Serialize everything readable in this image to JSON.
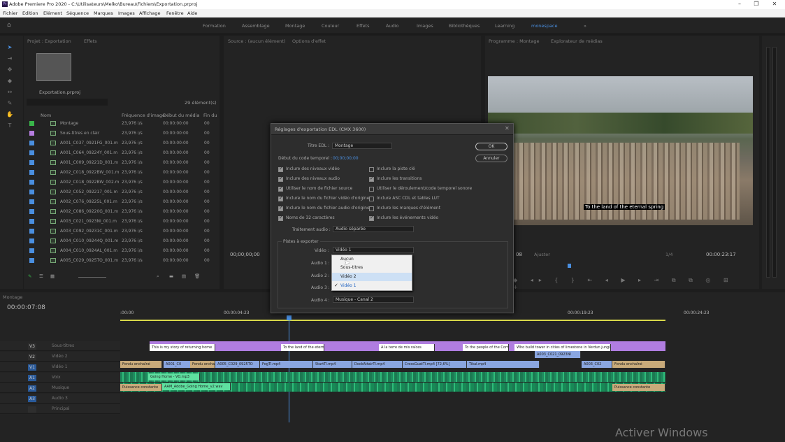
{
  "app": {
    "title": "Adobe Premiere Pro 2020 - C:\\Utilisateurs\\Melko\\Bureau\\Fichiers\\Exportation.prproj",
    "logo": "Pr"
  },
  "menu": [
    "Fichier",
    "Edition",
    "Elément",
    "Séquence",
    "Marques",
    "Images",
    "Affichage",
    "Fenêtre",
    "Aide"
  ],
  "workspaces": [
    "Formation",
    "Assemblage",
    "Montage",
    "Couleur",
    "Effets",
    "Audio",
    "Images",
    "Bibliothèques",
    "Learning",
    "monespace"
  ],
  "project": {
    "tab": "Projet : Exportation",
    "tab2": "Effets",
    "file": "Exportation.prproj",
    "count": "29 élément(s)",
    "cols": [
      "Nom",
      "Fréquence d'image",
      "Début du média",
      "Fin du"
    ],
    "rows": [
      {
        "name": "Montage",
        "fps": "23,976 i/s",
        "start": "00:00:00:00",
        "end": "00",
        "color": "#39b54a"
      },
      {
        "name": "Sous-titres en clair",
        "fps": "23,976 i/s",
        "start": "00:00:00:00",
        "end": "00",
        "color": "#b57de0"
      },
      {
        "name": "A001_C037_0921FG_001.m",
        "fps": "23,976 i/s",
        "start": "00:00:00:00",
        "end": "00",
        "color": "#4a8fe0"
      },
      {
        "name": "A001_C064_09224Y_001.m",
        "fps": "23,976 i/s",
        "start": "00:00:00:00",
        "end": "00",
        "color": "#4a8fe0"
      },
      {
        "name": "A001_C009_09221D_001.m",
        "fps": "23,976 i/s",
        "start": "00:00:00:00",
        "end": "00",
        "color": "#4a8fe0"
      },
      {
        "name": "A002_C018_0922BW_001.m",
        "fps": "23,976 i/s",
        "start": "00:00:00:00",
        "end": "00",
        "color": "#4a8fe0"
      },
      {
        "name": "A002_C018_0922BW_002.m",
        "fps": "23,976 i/s",
        "start": "00:00:00:00",
        "end": "00",
        "color": "#4a8fe0"
      },
      {
        "name": "A002_C052_092217_001.m",
        "fps": "23,976 i/s",
        "start": "00:00:00:00",
        "end": "00",
        "color": "#4a8fe0"
      },
      {
        "name": "A002_C076_09225L_001.m",
        "fps": "23,976 i/s",
        "start": "00:00:00:00",
        "end": "00",
        "color": "#4a8fe0"
      },
      {
        "name": "A002_C086_09220G_001.m",
        "fps": "23,976 i/s",
        "start": "00:00:00:00",
        "end": "00",
        "color": "#4a8fe0"
      },
      {
        "name": "A003_C021_0923NI_001.m",
        "fps": "23,976 i/s",
        "start": "00:00:00:00",
        "end": "00",
        "color": "#4a8fe0"
      },
      {
        "name": "A003_C092_09231C_001.m",
        "fps": "23,976 i/s",
        "start": "00:00:00:00",
        "end": "00",
        "color": "#4a8fe0"
      },
      {
        "name": "A004_C010_09244Q_001.m",
        "fps": "23,976 i/s",
        "start": "00:00:00:00",
        "end": "00",
        "color": "#4a8fe0"
      },
      {
        "name": "A004_C010_0924AL_001.m",
        "fps": "23,976 i/s",
        "start": "00:00:00:00",
        "end": "00",
        "color": "#4a8fe0"
      },
      {
        "name": "A005_C029_0925TO_001.m",
        "fps": "23,976 i/s",
        "start": "00:00:00:00",
        "end": "00",
        "color": "#4a8fe0"
      }
    ]
  },
  "source": {
    "tab": "Source : (aucun élément)",
    "tab2": "Options d'effet",
    "timecode": "00;00;00;00"
  },
  "program": {
    "tab": "Programme : Montage",
    "tab2": "Explorateur de médias",
    "subtitle": "To the land of the eternal spring",
    "timecode": "00:00:23:17",
    "fit": "Ajuster",
    "ratio": "1/4",
    "left_tc": "08"
  },
  "dialog": {
    "title": "Réglages d'exportation EDL (CMX 3600)",
    "title_label": "Titre EDL :",
    "title_value": "Montage",
    "start_label": "Début du code temporel :",
    "start_value": "00;00;00;00",
    "ok": "OK",
    "cancel": "Annuler",
    "left_checks": [
      {
        "label": "Inclure des niveaux vidéo",
        "on": true
      },
      {
        "label": "Inclure des niveaux audio",
        "on": true
      },
      {
        "label": "Utiliser le nom de fichier source",
        "on": true
      },
      {
        "label": "Inclure le nom du fichier vidéo d'origine",
        "on": true
      },
      {
        "label": "Inclure le nom du fichier audio d'origine",
        "on": true
      },
      {
        "label": "Noms de 32 caractères",
        "on": true
      }
    ],
    "right_checks": [
      {
        "label": "Inclure la piste clé",
        "on": false
      },
      {
        "label": "Inclure les transitions",
        "on": true
      },
      {
        "label": "Utiliser le déroulement/code temporel sonore",
        "on": false
      },
      {
        "label": "Inclure ASC CDL et tables LUT",
        "on": false
      },
      {
        "label": "Inclure les marques d'élément",
        "on": false
      },
      {
        "label": "Inclure les événements vidéo",
        "on": true
      }
    ],
    "audio_label": "Traitement audio :",
    "audio_value": "Audio séparée",
    "tracks_label": "Pistes à exporter",
    "video_label": "Vidéo :",
    "video_value": "Vidéo 1",
    "audio1": "Audio 1 :",
    "audio2": "Audio 2 :",
    "audio3": "Audio 3 :",
    "audio4": "Audio 4 :",
    "audio4_value": "Musique - Canal 2",
    "dropdown": [
      "Aucun",
      "Sous-titres",
      "Vidéo 2",
      "Vidéo 1"
    ]
  },
  "timeline": {
    "tab": "Montage",
    "timecode": "00:00:07:08",
    "ruler": [
      ":00:00",
      "00:00:04:23",
      "00:00:19:23",
      "00:00:24:23"
    ],
    "tracks": [
      {
        "id": "V3",
        "name": "Sous-titres"
      },
      {
        "id": "V2",
        "name": "Vidéo 2"
      },
      {
        "id": "V1",
        "name": "Vidéo 1"
      },
      {
        "id": "A1",
        "name": "Voix"
      },
      {
        "id": "A2",
        "name": "Musique"
      },
      {
        "id": "A3",
        "name": "Audio 3"
      },
      {
        "id": "",
        "name": "Principal"
      }
    ],
    "captions": [
      "This is my story of returning home",
      "To the land of the eternal",
      "A la terre de mis raíces",
      "To the people of the Com",
      "Who build tower in cities of limestone in Verdun jungles"
    ],
    "v2clip": "A003_C021_0923NI",
    "v1clips": [
      "Fondu enchaîné",
      "A001_C0",
      "Fondu enchaîné",
      "A005_C029_0925TO",
      "FogTl.mp4",
      "StartTl.mp4",
      "DockAttairTl.mp4",
      "CrossGuatTl.mp4 [72,6%]",
      "Tikal.mp4",
      "A003_C02",
      "Fondu enchaîné"
    ],
    "a1clip": "Going Home - VO.mp3",
    "a2clip": "AAM_Adobe_Going Home_v2.wav",
    "a2start": "Puissance constante",
    "a2end": "Puissance constante"
  },
  "watermark": "Activer Windows"
}
